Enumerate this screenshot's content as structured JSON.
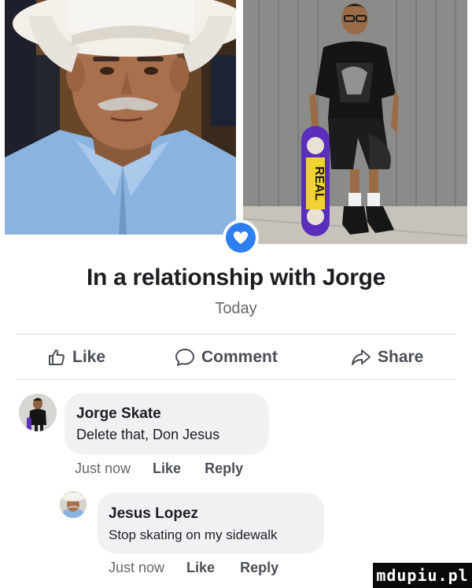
{
  "status": {
    "headline": "In a relationship with Jorge",
    "date": "Today"
  },
  "actions": {
    "like": "Like",
    "comment": "Comment",
    "share": "Share"
  },
  "comments": [
    {
      "author": "Jorge Skate",
      "text": "Delete that, Don Jesus",
      "time": "Just now",
      "like": "Like",
      "reply": "Reply"
    },
    {
      "author": "Jesus Lopez",
      "text": "Stop skating on my sidewalk",
      "time": "Just now",
      "like": "Like",
      "reply": "Reply"
    }
  ],
  "skateboard_text": "REAL",
  "watermark": "mdupiu.pl",
  "colors": {
    "accent_blue": "#2d7ef0",
    "action_gray": "#4b4f56",
    "secondary_gray": "#65676b",
    "bubble_bg": "#eff1f3",
    "skateboard_purple": "#5a2dbd",
    "skateboard_yellow": "#f2d230"
  },
  "icons": {
    "badge": "heart-icon",
    "like": "thumbs-up-icon",
    "comment": "comment-bubble-icon",
    "share": "share-arrow-icon"
  }
}
